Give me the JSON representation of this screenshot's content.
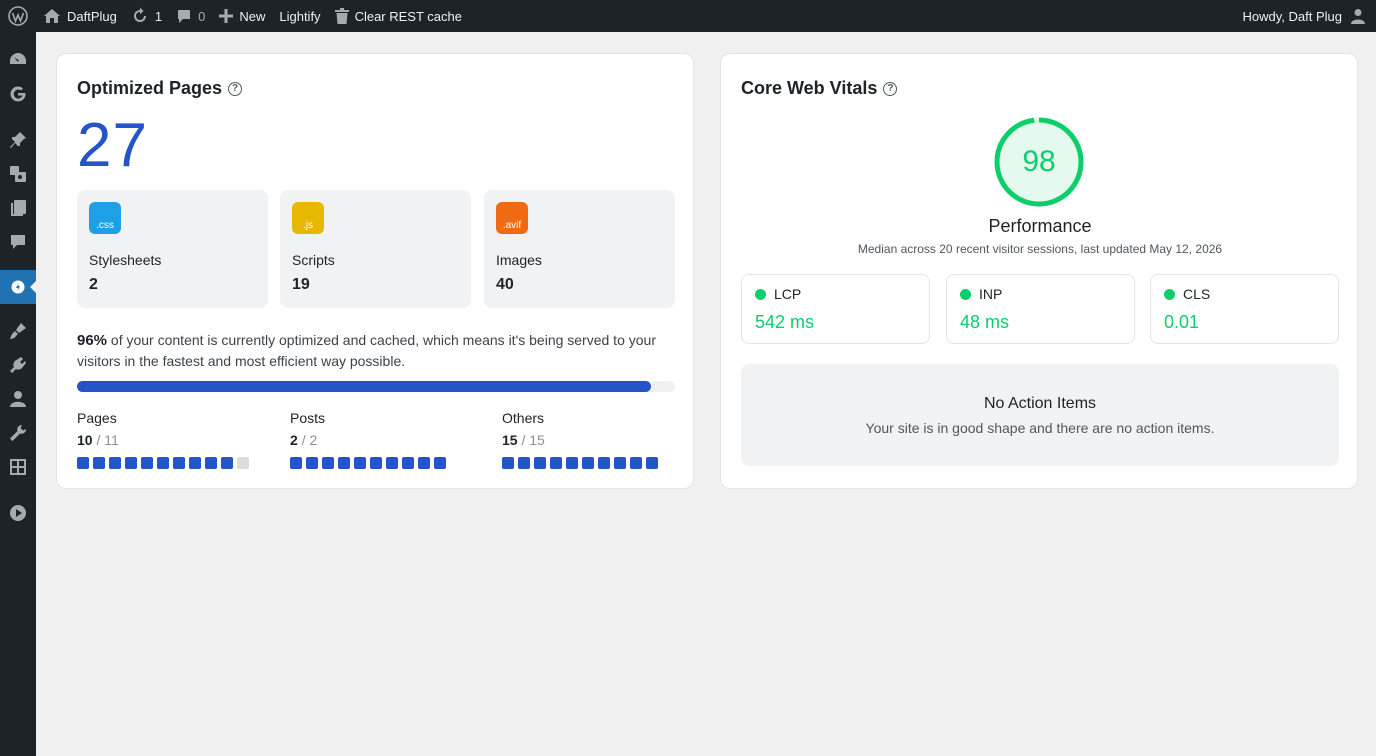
{
  "adminbar": {
    "site_name": "DaftPlug",
    "updates_count": "1",
    "comments_count": "0",
    "new_label": "New",
    "lightify_label": "Lightify",
    "clear_cache_label": "Clear REST cache",
    "howdy": "Howdy, Daft Plug"
  },
  "sidemenu": {
    "icons": [
      "dashboard-icon",
      "google-icon",
      "pin-icon",
      "media-icon",
      "pages-icon",
      "comments-icon",
      "lightify-icon",
      "appearance-icon",
      "plugins-icon",
      "users-icon",
      "tools-icon",
      "settings-icon",
      "play-icon"
    ],
    "active": "lightify-icon"
  },
  "optimized": {
    "title": "Optimized Pages",
    "total": "27",
    "assets": [
      {
        "badge": ".css",
        "label": "Stylesheets",
        "value": "2",
        "color": "#1ea0e6"
      },
      {
        "badge": ".js",
        "label": "Scripts",
        "value": "19",
        "color": "#e6b800"
      },
      {
        "badge": ".avif",
        "label": "Images",
        "value": "40",
        "color": "#f06a14"
      }
    ],
    "percent_label": "96%",
    "description": "of your content is currently optimized and cached, which means it's being served to your visitors in the fastest and most efficient way possible.",
    "progress": 0.96,
    "stats": [
      {
        "label": "Pages",
        "count": "10",
        "total": "/ 11",
        "filled": 10,
        "squares": 11
      },
      {
        "label": "Posts",
        "count": "2",
        "total": "/ 2",
        "filled": 10,
        "squares": 10
      },
      {
        "label": "Others",
        "count": "15",
        "total": "/ 15",
        "filled": 10,
        "squares": 10
      }
    ]
  },
  "vitals": {
    "title": "Core Web Vitals",
    "score": "98",
    "score_fraction": 0.98,
    "performance_label": "Performance",
    "subtitle": "Median across 20 recent visitor sessions, last updated May 12, 2026",
    "metrics": [
      {
        "name": "LCP",
        "value": "542 ms"
      },
      {
        "name": "INP",
        "value": "48 ms"
      },
      {
        "name": "CLS",
        "value": "0.01"
      }
    ],
    "action_title": "No Action Items",
    "action_sub": "Your site is in good shape and there are no action items."
  },
  "colors": {
    "accent": "#2355c9",
    "good": "#0cce6b",
    "admin_bar": "#1d2327"
  }
}
